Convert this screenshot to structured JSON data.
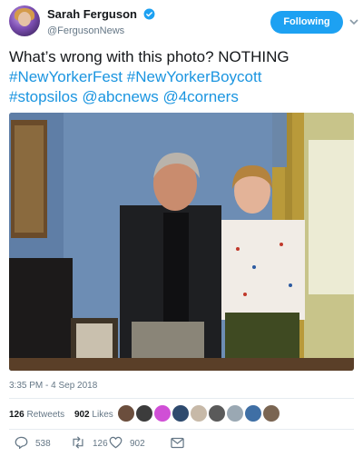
{
  "user": {
    "display_name": "Sarah Ferguson",
    "handle": "@FergusonNews",
    "follow_label": "Following",
    "verified_color": "#1da1f2"
  },
  "tweet": {
    "lines": [
      [
        {
          "t": "What’s wrong with this photo? NOTHING",
          "tag": false
        }
      ],
      [
        {
          "t": "#NewYorkerFest",
          "tag": true
        },
        {
          "t": " ",
          "tag": false
        },
        {
          "t": "#NewYorkerBoycott",
          "tag": true
        }
      ],
      [
        {
          "t": "#stopsilos",
          "tag": true
        },
        {
          "t": " ",
          "tag": false
        },
        {
          "t": "@abcnews",
          "tag": true
        },
        {
          "t": " ",
          "tag": false
        },
        {
          "t": "@4corners",
          "tag": true
        }
      ]
    ],
    "timestamp": "3:35 PM - 4 Sep 2018",
    "link_color": "#1b95e0"
  },
  "stats": {
    "retweets_count": "126",
    "retweets_label": "Retweets",
    "likes_count": "902",
    "likes_label": "Likes"
  },
  "likers": [
    "#6b4e3d",
    "#3c3c3c",
    "#d04fd6",
    "#2e4a6e",
    "#c7b9a8",
    "#5a5a5a",
    "#9aa8b3",
    "#3f6fa5",
    "#7a6552"
  ],
  "actions": {
    "replies": "538",
    "retweets": "126",
    "likes": "902"
  },
  "icons": {
    "reply": "reply-icon",
    "retweet": "retweet-icon",
    "like": "heart-icon",
    "dm": "envelope-icon",
    "more": "chevron-down-icon"
  }
}
